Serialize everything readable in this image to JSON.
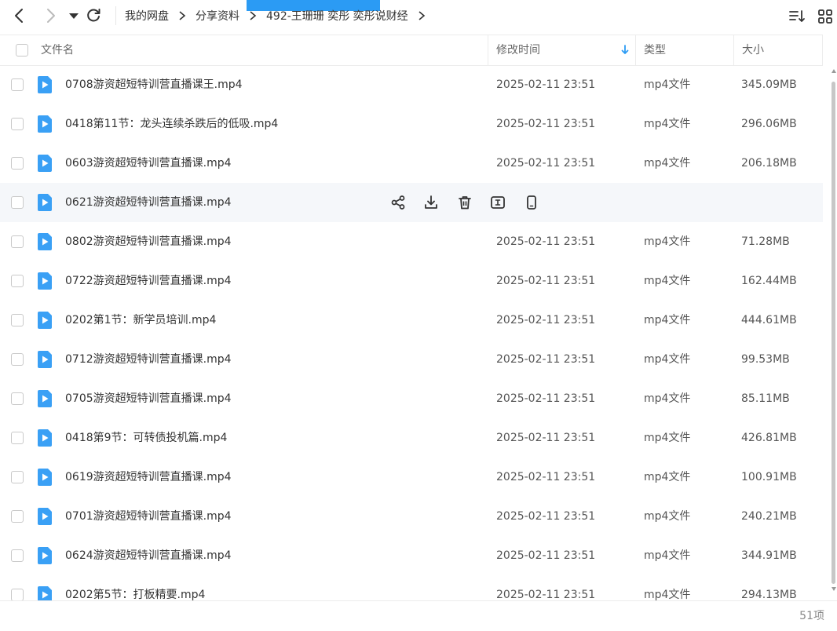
{
  "nav": {
    "breadcrumbs": [
      "我的网盘",
      "分享资料",
      "492-王珊珊 奕彤 奕彤说财经"
    ]
  },
  "table": {
    "columns": {
      "name": "文件名",
      "time": "修改时间",
      "type": "类型",
      "size": "大小"
    },
    "rows": [
      {
        "name": "0708游资超短特训营直播课王.mp4",
        "time": "2025-02-11 23:51",
        "type": "mp4文件",
        "size": "345.09MB"
      },
      {
        "name": "0418第11节：龙头连续杀跌后的低吸.mp4",
        "time": "2025-02-11 23:51",
        "type": "mp4文件",
        "size": "296.06MB"
      },
      {
        "name": "0603游资超短特训营直播课.mp4",
        "time": "2025-02-11 23:51",
        "type": "mp4文件",
        "size": "206.18MB"
      },
      {
        "name": "0621游资超短特训营直播课.mp4",
        "time": "",
        "type": "",
        "size": "",
        "hover": true
      },
      {
        "name": "0802游资超短特训营直播课.mp4",
        "time": "2025-02-11 23:51",
        "type": "mp4文件",
        "size": "71.28MB"
      },
      {
        "name": "0722游资超短特训营直播课.mp4",
        "time": "2025-02-11 23:51",
        "type": "mp4文件",
        "size": "162.44MB"
      },
      {
        "name": "0202第1节：新学员培训.mp4",
        "time": "2025-02-11 23:51",
        "type": "mp4文件",
        "size": "444.61MB"
      },
      {
        "name": "0712游资超短特训营直播课.mp4",
        "time": "2025-02-11 23:51",
        "type": "mp4文件",
        "size": "99.53MB"
      },
      {
        "name": "0705游资超短特训营直播课.mp4",
        "time": "2025-02-11 23:51",
        "type": "mp4文件",
        "size": "85.11MB"
      },
      {
        "name": "0418第9节：可转债投机篇.mp4",
        "time": "2025-02-11 23:51",
        "type": "mp4文件",
        "size": "426.81MB"
      },
      {
        "name": "0619游资超短特训营直播课.mp4",
        "time": "2025-02-11 23:51",
        "type": "mp4文件",
        "size": "100.91MB"
      },
      {
        "name": "0701游资超短特训营直播课.mp4",
        "time": "2025-02-11 23:51",
        "type": "mp4文件",
        "size": "240.21MB"
      },
      {
        "name": "0624游资超短特训营直播课.mp4",
        "time": "2025-02-11 23:51",
        "type": "mp4文件",
        "size": "344.91MB"
      },
      {
        "name": "0202第5节：打板精要.mp4",
        "time": "2025-02-11 23:51",
        "type": "mp4文件",
        "size": "294.13MB"
      }
    ],
    "row_actions": [
      "share-icon",
      "download-icon",
      "trash-icon",
      "rename-icon",
      "phone-icon"
    ]
  },
  "footer": {
    "count": "51项"
  },
  "colors": {
    "accent": "#2b9bf4",
    "file_icon": "#3aa0f5",
    "hover_row": "#f5f7fa"
  }
}
